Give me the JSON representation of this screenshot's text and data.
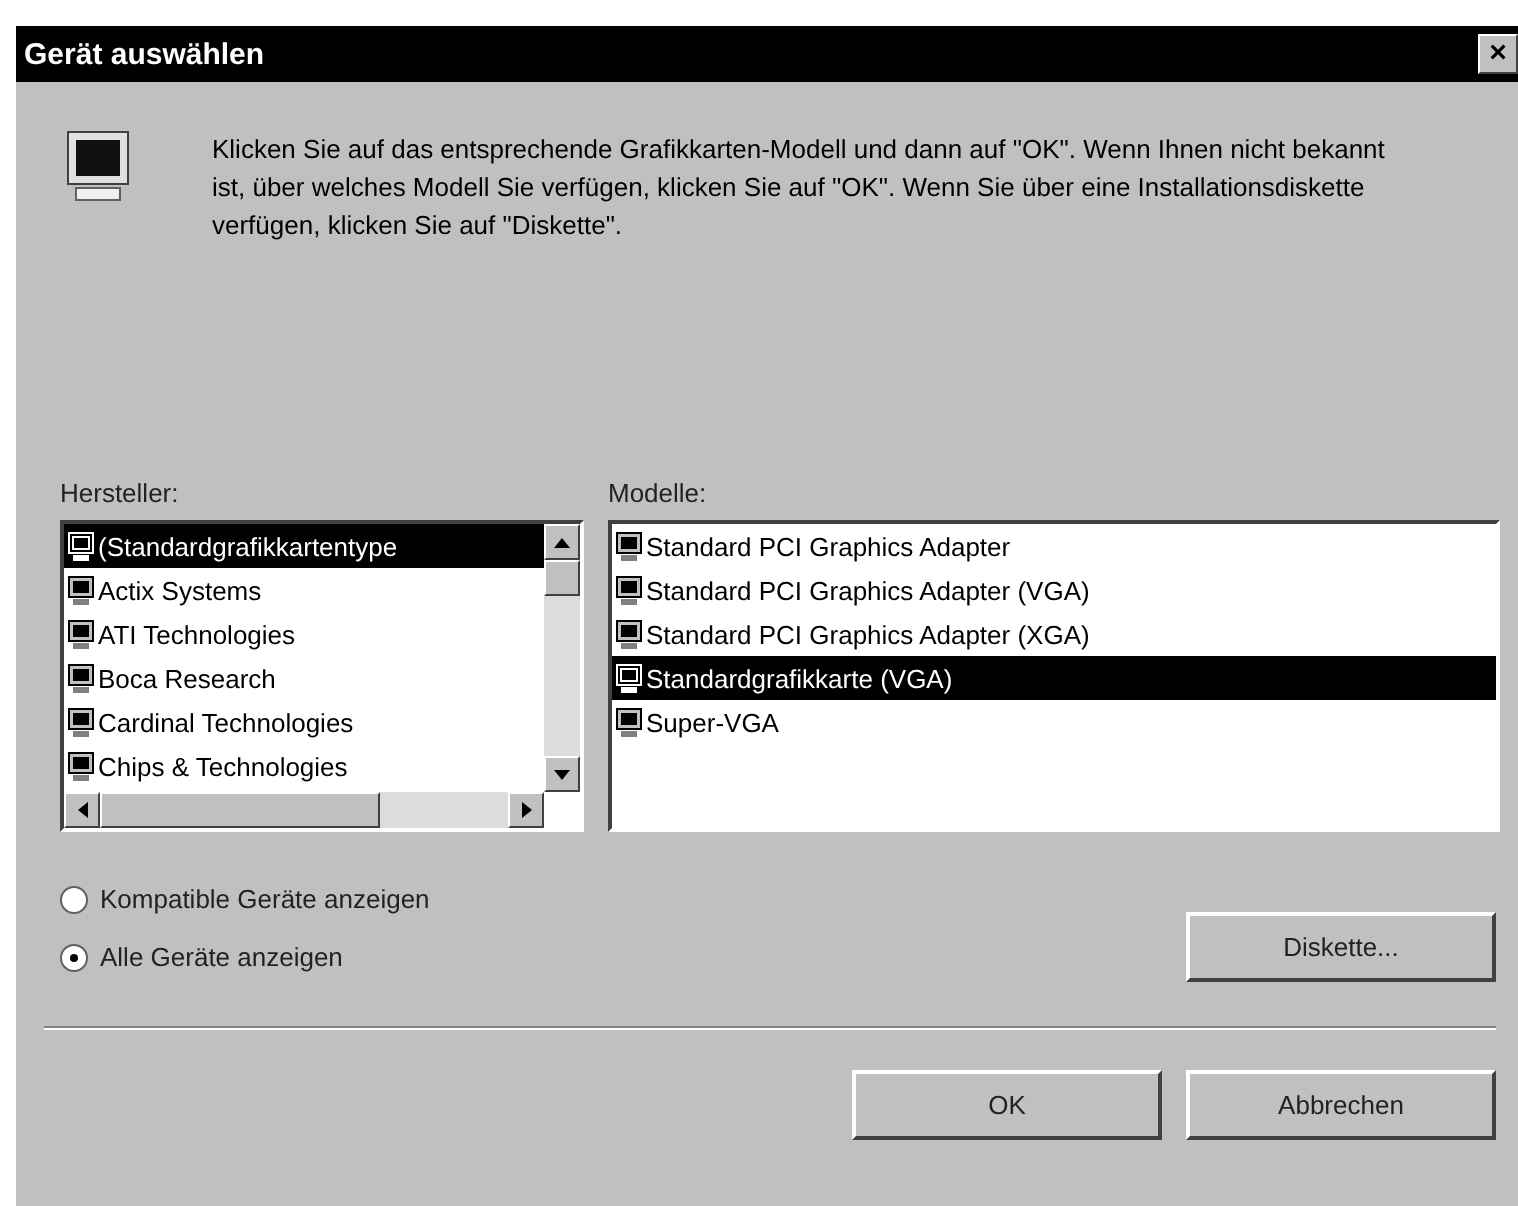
{
  "window": {
    "title": "Gerät auswählen",
    "close": "×"
  },
  "description": "Klicken Sie auf das entsprechende Grafikkarten-Modell und dann auf \"OK\". Wenn Ihnen nicht bekannt ist, über welches Modell Sie verfügen, klicken Sie auf \"OK\". Wenn Sie über eine Installationsdiskette verfügen, klicken Sie auf \"Diskette\".",
  "manufacturers": {
    "label": "Hersteller:",
    "items": [
      {
        "label": "(Standardgrafikkartentype",
        "selected": true
      },
      {
        "label": "Actix Systems",
        "selected": false
      },
      {
        "label": "ATI Technologies",
        "selected": false
      },
      {
        "label": "Boca Research",
        "selected": false
      },
      {
        "label": "Cardinal Technologies",
        "selected": false
      },
      {
        "label": "Chips & Technologies",
        "selected": false
      }
    ]
  },
  "models": {
    "label": "Modelle:",
    "items": [
      {
        "label": "Standard PCI Graphics Adapter",
        "selected": false
      },
      {
        "label": "Standard PCI Graphics Adapter (VGA)",
        "selected": false
      },
      {
        "label": "Standard PCI Graphics Adapter (XGA)",
        "selected": false
      },
      {
        "label": "Standardgrafikkarte (VGA)",
        "selected": true
      },
      {
        "label": "Super-VGA",
        "selected": false
      }
    ]
  },
  "filter": [
    {
      "label": "Kompatible Geräte anzeigen",
      "selected": false
    },
    {
      "label": "Alle Geräte anzeigen",
      "selected": true
    }
  ],
  "disk_button": "Diskette...",
  "buttons": [
    "OK",
    "Abbrechen"
  ]
}
